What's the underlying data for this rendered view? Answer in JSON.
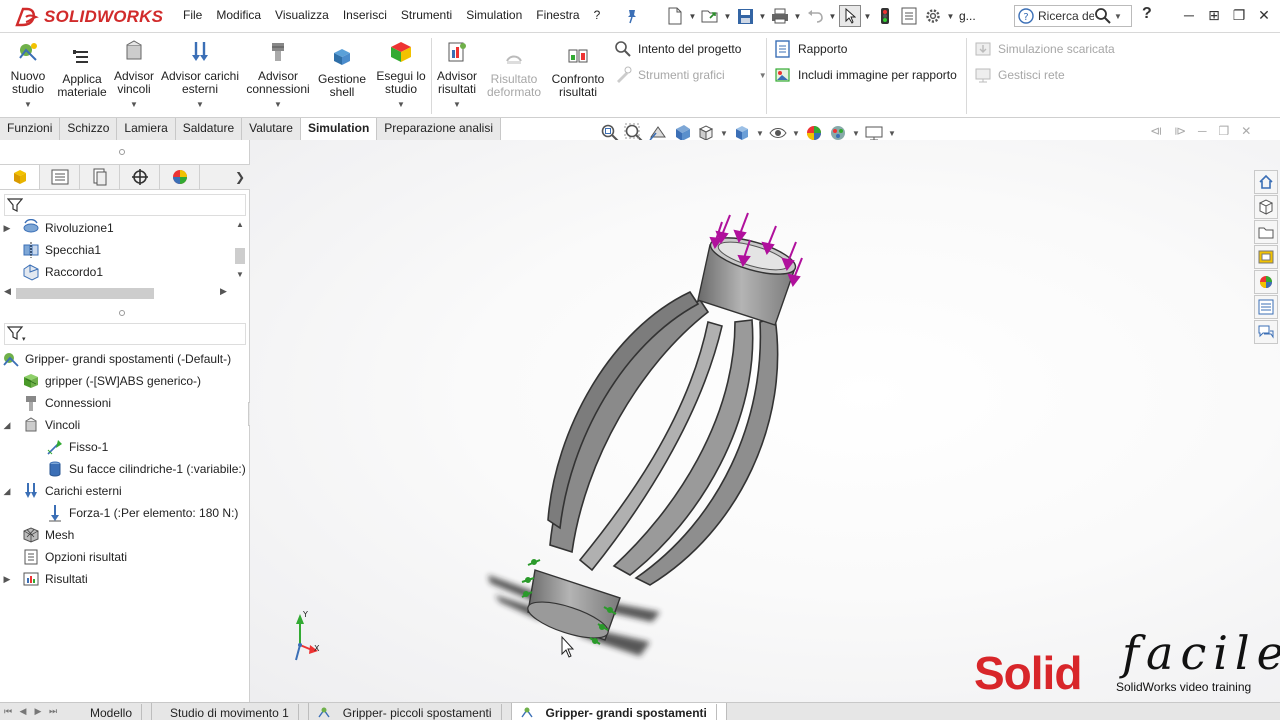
{
  "app": {
    "brand": "SOLIDWORKS",
    "menus": [
      "File",
      "Modifica",
      "Visualizza",
      "Inserisci",
      "Strumenti",
      "Simulation",
      "Finestra",
      "?"
    ],
    "search_placeholder": "Ricerca del",
    "search_prefix": "g...",
    "help": "?"
  },
  "ribbon": {
    "buttons": [
      {
        "label_1": "Nuovo",
        "label_2": "studio",
        "enabled": true
      },
      {
        "label_1": "Applica",
        "label_2": "materiale",
        "enabled": true
      },
      {
        "label_1": "Advisor",
        "label_2": "vincoli",
        "enabled": true
      },
      {
        "label_1": "Advisor carichi",
        "label_2": "esterni",
        "enabled": true
      },
      {
        "label_1": "Advisor",
        "label_2": "connessioni",
        "enabled": true
      },
      {
        "label_1": "Gestione",
        "label_2": "shell",
        "enabled": true
      },
      {
        "label_1": "Esegui lo",
        "label_2": "studio",
        "enabled": true
      },
      {
        "label_1": "Advisor",
        "label_2": "risultati",
        "enabled": true
      },
      {
        "label_1": "Risultato",
        "label_2": "deformato",
        "enabled": false
      },
      {
        "label_1": "Confronto",
        "label_2": "risultati",
        "enabled": true
      }
    ],
    "design_intent": "Intento del progetto",
    "graphic_tools": "Strumenti grafici",
    "report": "Rapporto",
    "include_image": "Includi immagine per rapporto",
    "downloaded_sim": "Simulazione scaricata",
    "manage_network": "Gestisci rete"
  },
  "command_tabs": [
    "Funzioni",
    "Schizzo",
    "Lamiera",
    "Saldature",
    "Valutare",
    "Simulation",
    "Preparazione analisi"
  ],
  "active_command_tab": "Simulation",
  "feature_tree": {
    "items": [
      "Rivoluzione1",
      "Specchia1",
      "Raccordo1"
    ]
  },
  "study_tree": {
    "root": "Gripper- grandi spostamenti (-Default-)",
    "material": "gripper (-[SW]ABS generico-)",
    "connections": "Connessioni",
    "fixtures": "Vincoli",
    "fixed": "Fisso-1",
    "cylindrical": "Su facce cilindriche-1 (:variabile:)",
    "external_loads": "Carichi esterni",
    "force": "Forza-1 (:Per elemento: 180 N:)",
    "mesh": "Mesh",
    "result_options": "Opzioni risultati",
    "results": "Risultati"
  },
  "triad": {
    "y": "Y",
    "x": "X"
  },
  "bottom_tabs": [
    "Modello",
    "Studio di movimento 1",
    "Gripper- piccoli spostamenti",
    "Gripper- grandi spostamenti"
  ],
  "active_bottom_tab": "Gripper- grandi spostamenti",
  "watermark": {
    "solid": "Solid",
    "facile": "facile",
    "subtitle": "SolidWorks video training"
  },
  "colors": {
    "brand_red": "#d12b2b",
    "force_arrow": "#b0109c",
    "fixture": "#2a9a2a",
    "part_gray": "#8f8f8f"
  }
}
